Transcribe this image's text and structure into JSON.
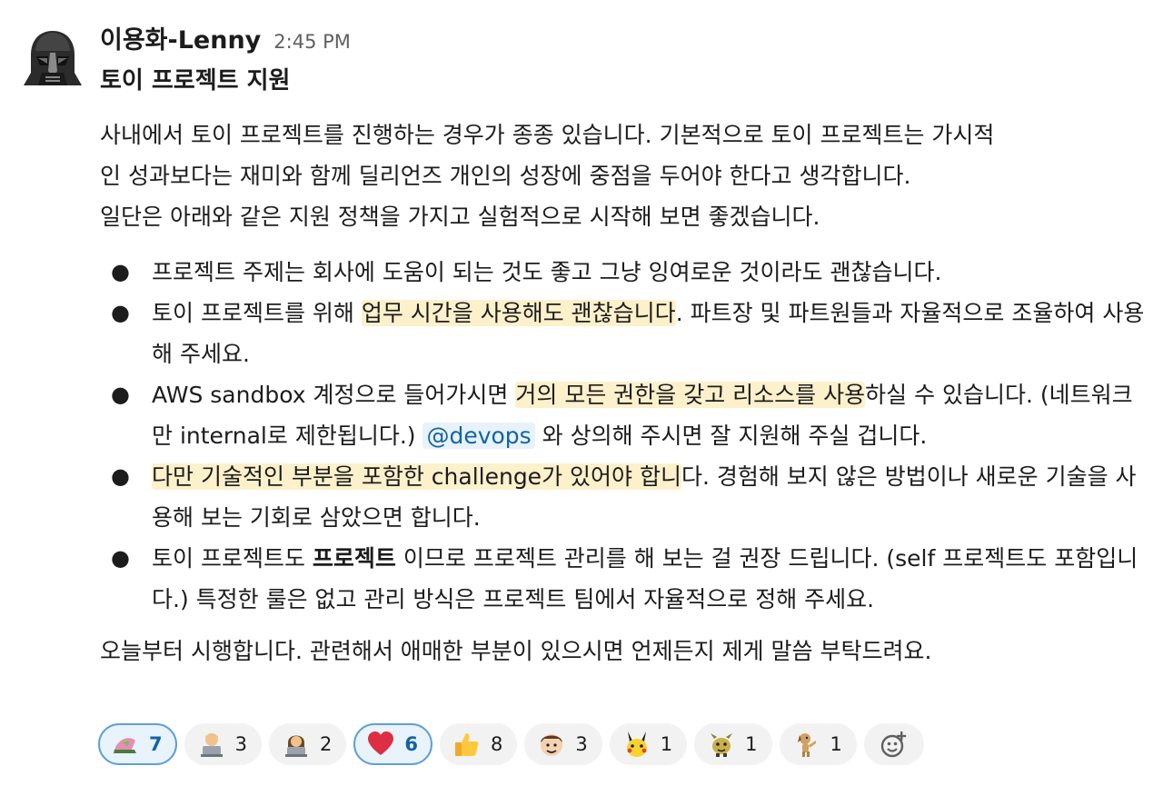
{
  "message": {
    "author": "이용화-Lenny",
    "time": "2:45 PM",
    "title": "토이 프로젝트 지원",
    "intro_line1": "사내에서 토이 프로젝트를 진행하는 경우가 종종 있습니다. 기본적으로 토이 프로젝트는 가시적",
    "intro_line2": "인 성과보다는 재미와 함께 딜리언즈 개인의 성장에 중점을 두어야 한다고 생각합니다.",
    "intro_line3": "일단은 아래와 같은 지원 정책을 가지고 실험적으로 시작해 보면 좋겠습니다.",
    "bullet": "●",
    "b1": "프로젝트 주제는 회사에 도움이 되는 것도 좋고 그냥 잉여로운 것이라도 괜찮습니다.",
    "b2_pre": "토이 프로젝트를 위해 ",
    "b2_hl": "업무 시간을 사용해도 괜찮습니다",
    "b2_post": ". 파트장 및 파트원들과 자율적으로 조율하여 사용해 주세요.",
    "b3_pre": "AWS sandbox 계정으로 들어가시면 ",
    "b3_hl": "거의 모든 권한을 갖고 리소스를 사용",
    "b3_mid": "하실 수 있습니다. (네트워크만 internal로 제한됩니다.) ",
    "b3_mention": "@devops",
    "b3_post": " 와 상의해 주시면 잘 지원해 주실 겁니다.",
    "b4_hl": "다만 기술적인 부분을 포함한 challenge가 있어야 합니",
    "b4_post": "다. 경험해 보지 않은 방법이나 새로운 기술을 사용해 보는 기회로 삼았으면 합니다.",
    "b5_pre": "토이 프로젝트도 ",
    "b5_bold": "프로젝트",
    "b5_post": " 이므로 프로젝트 관리를 해 보는 걸 권장 드립니다. (self 프로젝트도 포함입니다.) 특정한 룰은 없고 관리 방식은 프로젝트 팀에서 자율적으로 정해 주세요.",
    "closing": "오늘부터 시행합니다. 관련해서 애매한 부분이 있으시면 언제든지 제게 말씀 부탁드려요."
  },
  "reactions": [
    {
      "icon": "pink-hat-emoji",
      "count": "7",
      "active": true
    },
    {
      "icon": "developer-emoji",
      "count": "3",
      "active": false
    },
    {
      "icon": "developer-woman-emoji",
      "count": "2",
      "active": false
    },
    {
      "icon": "red-heart-emoji",
      "count": "6",
      "active": true
    },
    {
      "icon": "thumbs-up-emoji",
      "count": "8",
      "active": false
    },
    {
      "icon": "face-emoji",
      "count": "3",
      "active": false
    },
    {
      "icon": "pikachu-emoji",
      "count": "1",
      "active": false
    },
    {
      "icon": "dancing-creature-emoji",
      "count": "1",
      "active": false
    },
    {
      "icon": "dancing-dog-emoji",
      "count": "1",
      "active": false
    }
  ],
  "colors": {
    "highlight": "#fdf1cc",
    "mention_bg": "#e8f2fb",
    "mention_text": "#1264a3",
    "active_reaction_border": "#5f9fd8"
  }
}
